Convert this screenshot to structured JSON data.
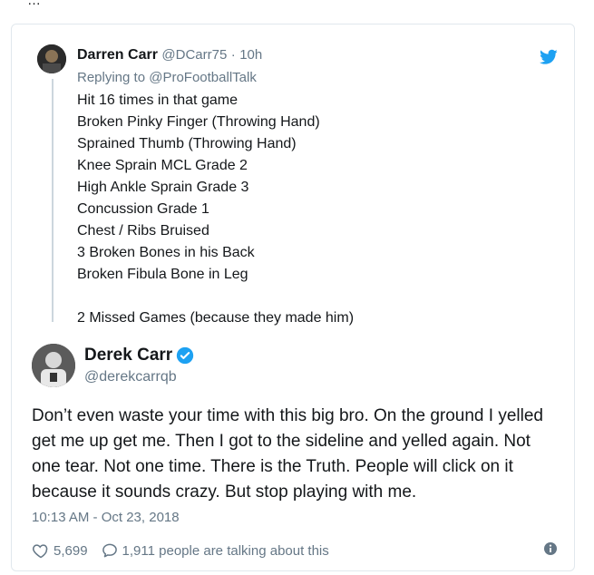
{
  "page": {
    "top_snippet": "…"
  },
  "parent_tweet": {
    "name": "Darren Carr",
    "handle": "@DCarr75",
    "separator": "·",
    "time": "10h",
    "reply_prefix": "Replying to",
    "reply_to": "@ProFootballTalk",
    "lines": [
      "Hit 16 times in that game",
      "Broken Pinky Finger (Throwing Hand)",
      "Sprained Thumb (Throwing Hand)",
      "Knee Sprain MCL Grade 2",
      "High Ankle Sprain Grade 3",
      "Concussion Grade 1",
      "Chest / Ribs Bruised",
      "3 Broken Bones in his Back",
      "Broken Fibula Bone in Leg"
    ],
    "final_line": "2 Missed Games (because they made him)"
  },
  "main_tweet": {
    "name": "Derek Carr",
    "handle": "@derekcarrqb",
    "text": "Don’t even waste your time with this big bro. On the ground I yelled get me up get me. Then I got to the sideline and yelled again. Not one tear. Not one time. There is the Truth. People will click on it because it sounds crazy. But stop playing with me.",
    "timestamp": "10:13 AM - Oct 23, 2018"
  },
  "actions": {
    "like_count": "5,699",
    "talking_text": "1,911 people are talking about this"
  },
  "colors": {
    "twitter_blue": "#1da1f2",
    "muted": "#657786",
    "text": "#14171a",
    "border": "#e1e8ed"
  }
}
